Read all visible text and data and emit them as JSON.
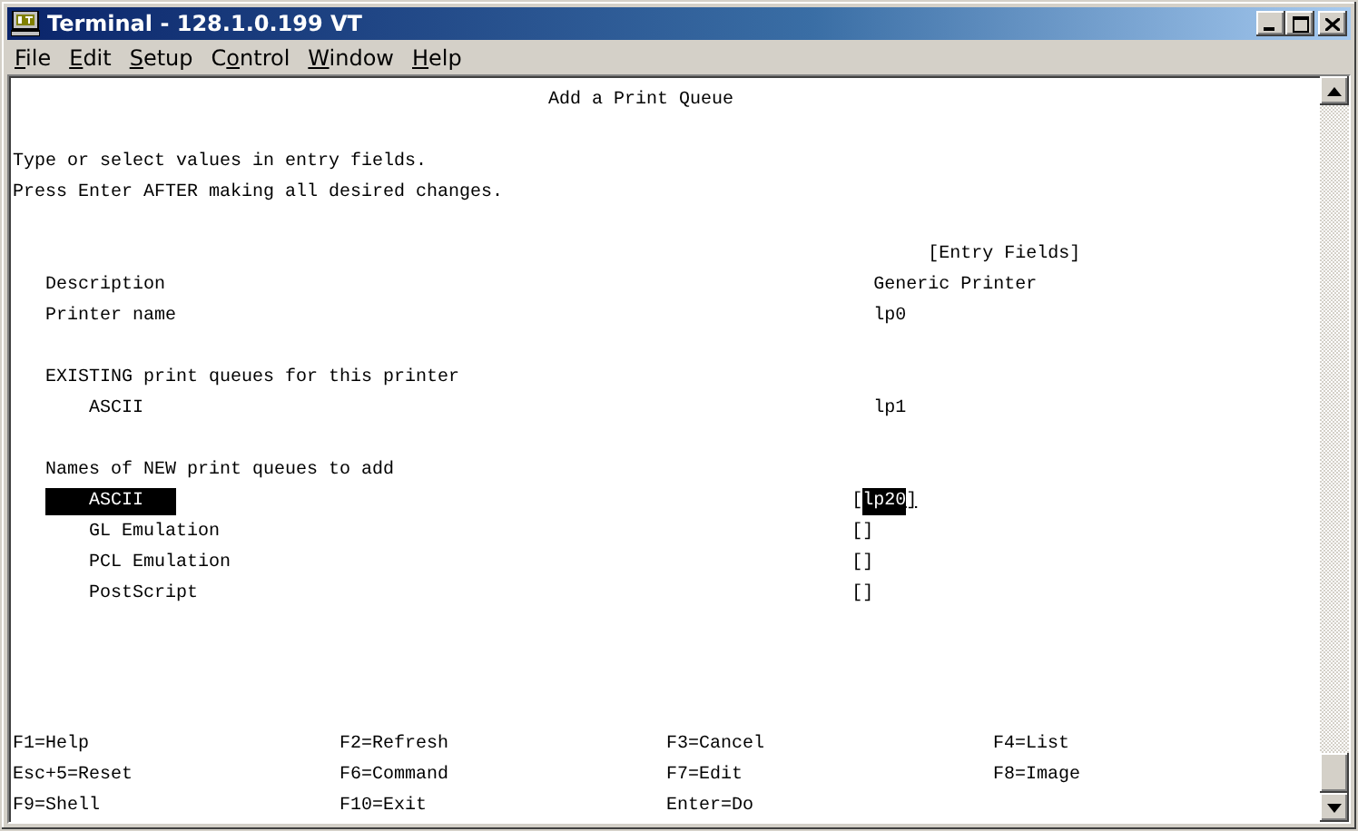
{
  "window": {
    "title": "Terminal - 128.1.0.199 VT"
  },
  "menu": [
    {
      "key": "F",
      "post": "ile"
    },
    {
      "key": "E",
      "post": "dit"
    },
    {
      "key": "S",
      "post": "etup"
    },
    {
      "pre": "C",
      "key": "o",
      "post": "ntrol"
    },
    {
      "key": "W",
      "post": "indow"
    },
    {
      "key": "H",
      "post": "elp"
    }
  ],
  "screen": {
    "title": "Add a Print Queue",
    "instructions": [
      "Type or select values in entry fields.",
      "Press Enter AFTER making all desired changes."
    ],
    "column_header": "[Entry Fields]",
    "sections": [
      {
        "items": [
          {
            "kind": "info",
            "label": "Description",
            "value": "Generic Printer"
          },
          {
            "kind": "info",
            "label": "Printer name",
            "value": "lp0"
          }
        ]
      },
      {
        "heading": "EXISTING print queues for this printer",
        "items": [
          {
            "kind": "info",
            "label": "ASCII",
            "value": "lp1"
          }
        ]
      },
      {
        "heading": "Names of NEW print queues to add",
        "items": [
          {
            "kind": "entry",
            "label": "ASCII",
            "open": "[",
            "value": "lp20",
            "close": "]",
            "selected": true
          },
          {
            "kind": "entry",
            "label": "GL Emulation",
            "open": "[",
            "close": "]",
            "selected": false
          },
          {
            "kind": "entry",
            "label": "PCL Emulation",
            "open": "[",
            "close": "]",
            "selected": false
          },
          {
            "kind": "entry",
            "label": "PostScript",
            "open": "[",
            "close": "]",
            "selected": false
          }
        ]
      }
    ],
    "function_keys": [
      "F1=Help",
      "F2=Refresh",
      "F3=Cancel",
      "F4=List",
      "Esc+5=Reset",
      "F6=Command",
      "F7=Edit",
      "F8=Image",
      "F9=Shell",
      "F10=Exit",
      "Enter=Do"
    ]
  }
}
